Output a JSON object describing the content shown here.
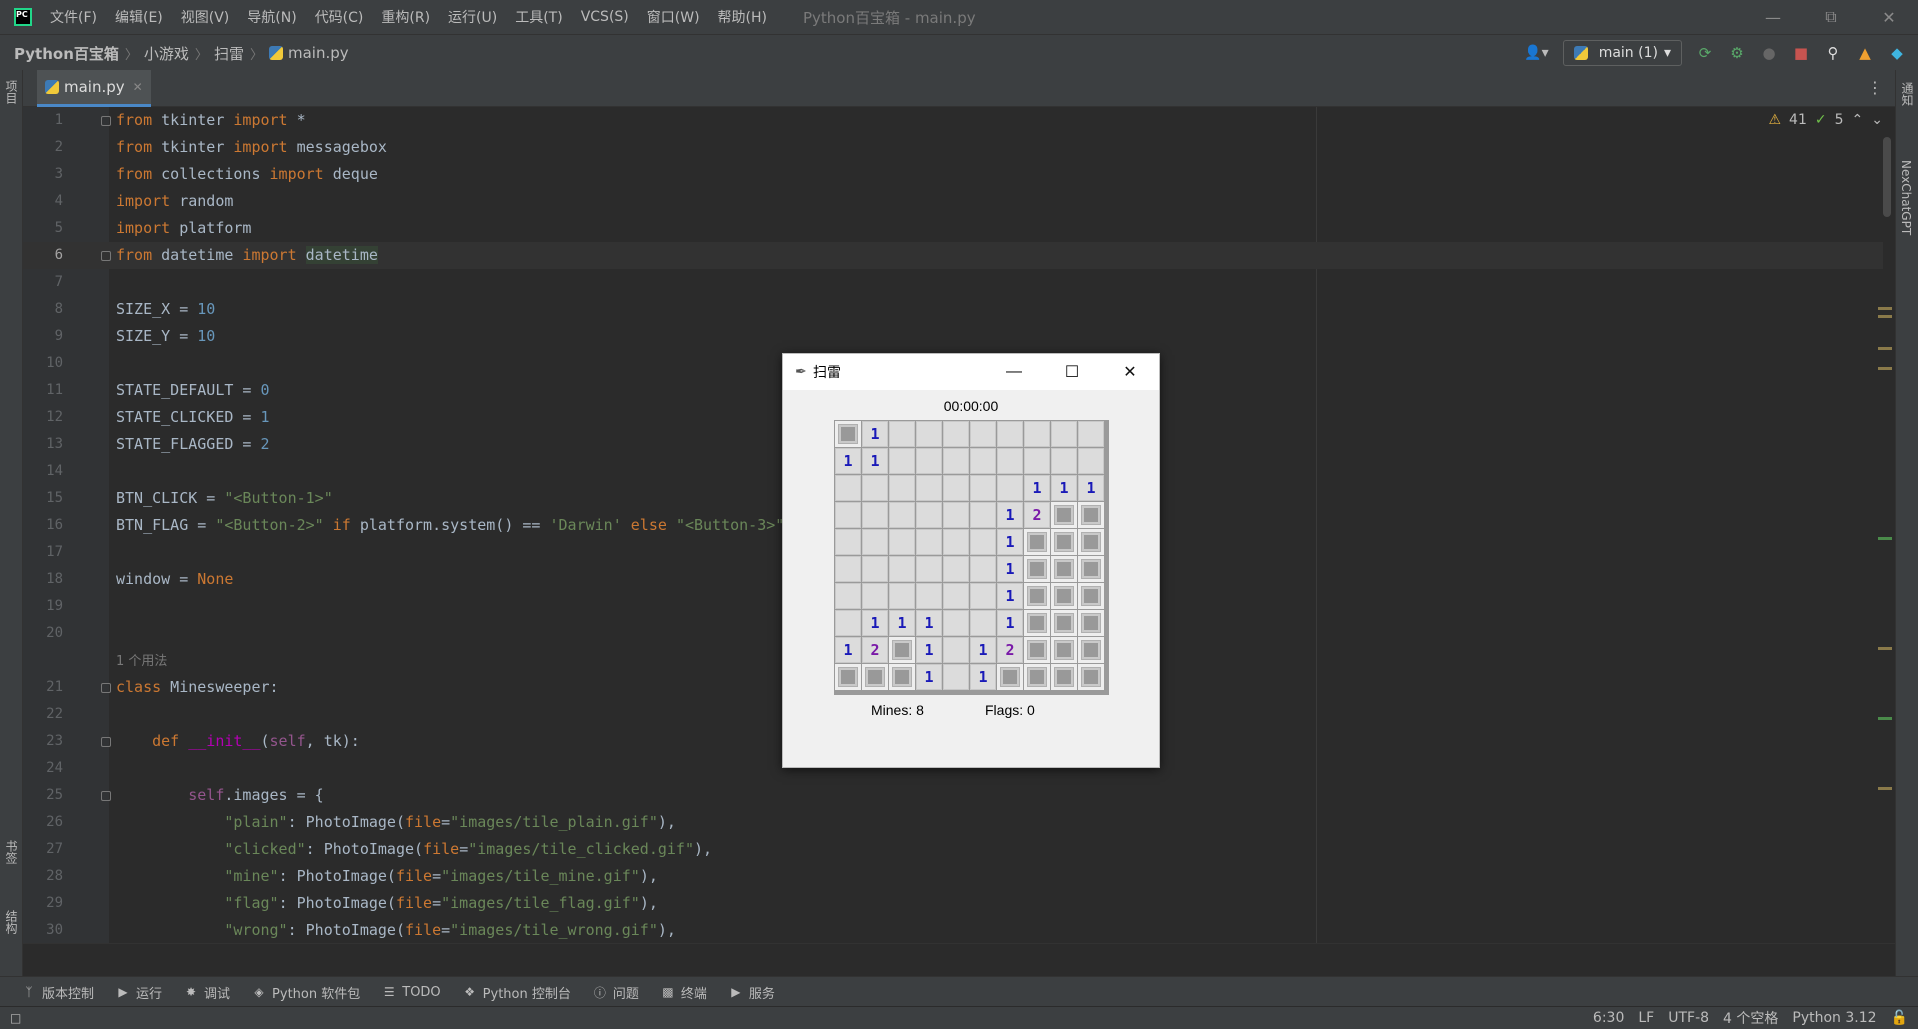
{
  "menubar": {
    "logo": "PC",
    "items": [
      "文件(F)",
      "编辑(E)",
      "视图(V)",
      "导航(N)",
      "代码(C)",
      "重构(R)",
      "运行(U)",
      "工具(T)",
      "VCS(S)",
      "窗口(W)",
      "帮助(H)"
    ],
    "title": "Python百宝箱 - main.py"
  },
  "navbar": {
    "crumbs": [
      "Python百宝箱",
      "小游戏",
      "扫雷",
      "main.py"
    ],
    "branch": "main (1)"
  },
  "left_strip": {
    "top_label": "项目",
    "bottom_label1": "书签",
    "bottom_label2": "结构"
  },
  "right_strip": {
    "label1": "通知",
    "label2": "NexChatGPT"
  },
  "tabs": {
    "active": "main.py"
  },
  "inspections": {
    "warnings": "41",
    "ok": "5"
  },
  "editor": {
    "lines": [
      {
        "n": "1"
      },
      {
        "n": "2"
      },
      {
        "n": "3"
      },
      {
        "n": "4"
      },
      {
        "n": "5"
      },
      {
        "n": "6"
      },
      {
        "n": "7"
      },
      {
        "n": "8"
      },
      {
        "n": "9"
      },
      {
        "n": "10"
      },
      {
        "n": "11"
      },
      {
        "n": "12"
      },
      {
        "n": "13"
      },
      {
        "n": "14"
      },
      {
        "n": "15"
      },
      {
        "n": "16"
      },
      {
        "n": "17"
      },
      {
        "n": "18"
      },
      {
        "n": "19"
      },
      {
        "n": "20"
      },
      {
        "n": ""
      },
      {
        "n": "21"
      },
      {
        "n": "22"
      },
      {
        "n": "23"
      },
      {
        "n": "24"
      },
      {
        "n": "25"
      },
      {
        "n": "26"
      },
      {
        "n": "27"
      },
      {
        "n": "28"
      },
      {
        "n": "29"
      },
      {
        "n": "30"
      }
    ],
    "usage_hint": "1 个用法"
  },
  "minesweeper": {
    "title": "扫雷",
    "timer": "00:00:00",
    "mines_label": "Mines: 8",
    "flags_label": "Flags: 0",
    "board": [
      [
        "P",
        "1",
        "C",
        "C",
        "C",
        "C",
        "C",
        "C",
        "C",
        "C"
      ],
      [
        "1",
        "1",
        "C",
        "C",
        "C",
        "C",
        "C",
        "C",
        "C",
        "C"
      ],
      [
        "C",
        "C",
        "C",
        "C",
        "C",
        "C",
        "C",
        "1",
        "1",
        "1"
      ],
      [
        "C",
        "C",
        "C",
        "C",
        "C",
        "C",
        "1",
        "2",
        "P",
        "P"
      ],
      [
        "C",
        "C",
        "C",
        "C",
        "C",
        "C",
        "1",
        "P",
        "P",
        "P"
      ],
      [
        "C",
        "C",
        "C",
        "C",
        "C",
        "C",
        "1",
        "P",
        "P",
        "P"
      ],
      [
        "C",
        "C",
        "C",
        "C",
        "C",
        "C",
        "1",
        "P",
        "P",
        "P"
      ],
      [
        "C",
        "1",
        "1",
        "1",
        "C",
        "C",
        "1",
        "P",
        "P",
        "P"
      ],
      [
        "1",
        "2",
        "P",
        "1",
        "C",
        "1",
        "2",
        "P",
        "P",
        "P"
      ],
      [
        "P",
        "P",
        "P",
        "1",
        "C",
        "1",
        "P",
        "P",
        "P",
        "P"
      ]
    ]
  },
  "toolwindows": [
    "版本控制",
    "运行",
    "调试",
    "Python 软件包",
    "TODO",
    "Python 控制台",
    "问题",
    "终端",
    "服务"
  ],
  "status": {
    "position": "6:30",
    "line_sep": "LF",
    "encoding": "UTF-8",
    "indent": "4 个空格",
    "interpreter": "Python 3.12"
  }
}
